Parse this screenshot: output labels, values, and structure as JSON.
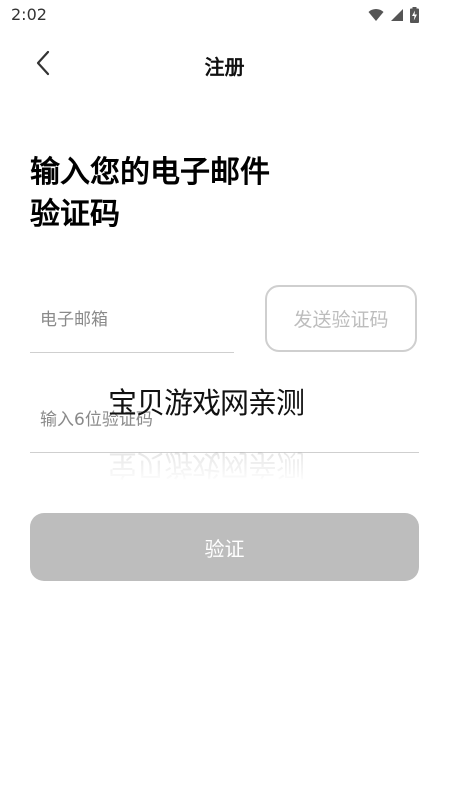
{
  "status_bar": {
    "time": "2:02",
    "icons": [
      "wifi-icon",
      "cellular-signal-icon",
      "battery-charging-icon"
    ]
  },
  "nav": {
    "title": "注册",
    "back_icon": "chevron-left-icon"
  },
  "heading": {
    "line1": "输入您的电子邮件",
    "line2": "验证码"
  },
  "form": {
    "email_placeholder": "电子邮箱",
    "email_value": "",
    "send_code_label": "发送验证码",
    "code_placeholder": "输入6位验证码",
    "code_value": "",
    "verify_label": "验证"
  },
  "watermark": {
    "text": "宝贝游戏网亲测"
  },
  "colors": {
    "disabled_button_bg": "#bdbdbd",
    "border": "#cfcfcf",
    "placeholder": "#8a8a8a",
    "send_code_text": "#bdbdbd"
  }
}
